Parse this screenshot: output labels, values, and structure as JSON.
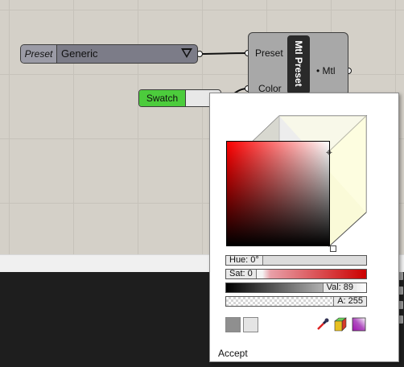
{
  "canvas": {
    "preset_list": {
      "tag": "Preset",
      "value": "Generic"
    },
    "component": {
      "title": "Mtl Preset",
      "inputs": [
        "Preset",
        "Color"
      ],
      "output": "Mtl"
    },
    "swatch": {
      "tag": "Swatch"
    }
  },
  "picker": {
    "hue_label": "Hue: 0°",
    "sat_label": "Sat: 0",
    "val_label": "Val: 89",
    "alpha_label": "A: 255",
    "accept_label": "Accept",
    "colors": {
      "current": "#ff0000",
      "preset_dark": "#8f8f8f",
      "preset_light": "#e4e4e4"
    },
    "icons": [
      "eyedropper-icon",
      "rgb-cube-icon",
      "gradient-icon"
    ]
  }
}
